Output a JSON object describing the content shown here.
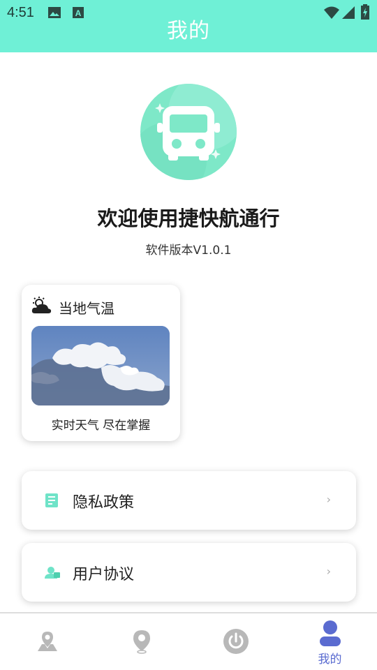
{
  "status_bar": {
    "time": "4:51",
    "icons": [
      "image-icon",
      "font-app-icon",
      "wifi-icon",
      "signal-icon",
      "battery-charging-icon"
    ]
  },
  "header": {
    "title": "我的"
  },
  "app": {
    "logo_icon": "bus-icon",
    "welcome": "欢迎使用捷快航通行",
    "version": "软件版本V1.0.1"
  },
  "weather_card": {
    "icon": "partly-cloudy-icon",
    "title": "当地气温",
    "caption": "实时天气 尽在掌握"
  },
  "menu": [
    {
      "label": "隐私政策",
      "icon": "document-icon",
      "chevron": "›"
    },
    {
      "label": "用户协议",
      "icon": "user-agreement-icon",
      "chevron": "›"
    }
  ],
  "bottom_nav": {
    "items": [
      {
        "icon": "map-location-icon",
        "label": ""
      },
      {
        "icon": "location-pin-icon",
        "label": ""
      },
      {
        "icon": "power-icon",
        "label": ""
      },
      {
        "icon": "person-icon",
        "label": "我的",
        "active": true
      }
    ]
  },
  "colors": {
    "header_bg": "#6ff0d6",
    "accent_teal": "#6fe3c8",
    "nav_active": "#5a6bd0",
    "nav_inactive": "#b8b8b8"
  }
}
